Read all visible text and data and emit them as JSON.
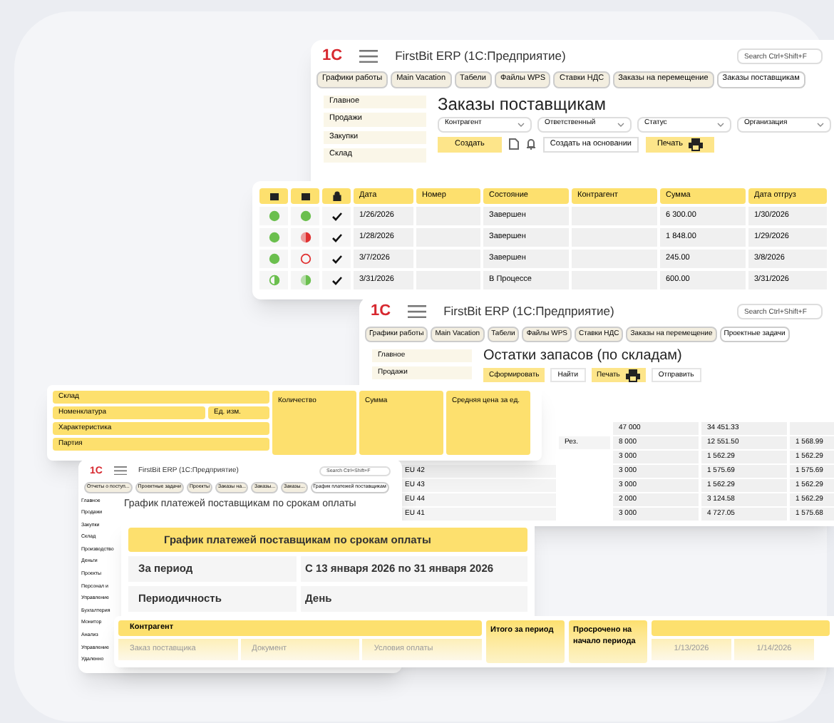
{
  "orders_window": {
    "logo": "1С",
    "title": "FirstBit ERP (1С:Предприятие)",
    "search": {
      "placeholder": "Search Ctrl+Shift+F"
    },
    "tabs": [
      {
        "label": "Графики работы",
        "selected": false
      },
      {
        "label": "Main Vacation",
        "selected": false
      },
      {
        "label": "Табели",
        "selected": false
      },
      {
        "label": "Файлы WPS",
        "selected": false
      },
      {
        "label": "Ставки НДС",
        "selected": false
      },
      {
        "label": "Заказы на перемещение",
        "selected": false
      },
      {
        "label": "Заказы поставщикам",
        "selected": true
      }
    ],
    "sidebar": [
      "Главное",
      "Продажи",
      "Закупки",
      "Склад"
    ],
    "heading": "Заказы поставщикам",
    "filters": [
      "Контрагент",
      "Ответственный",
      "Статус",
      "Организация"
    ],
    "create_button": "Создать",
    "create_based_button": "Создать на основании",
    "print_button": "Печать"
  },
  "orders_table": {
    "columns": [
      "Дата",
      "Номер",
      "Состояние",
      "Контрагент",
      "Сумма",
      "Дата отгруз"
    ],
    "rows": [
      {
        "status": {
          "kind": "full",
          "color": "#6bbf4e"
        },
        "payment": {
          "kind": "full",
          "color": "#6bbf4e"
        },
        "posted": true,
        "date": "1/26/2026",
        "number": "",
        "state": "Завершен",
        "counterparty": "",
        "sum": "6 300.00",
        "ship_date": "1/30/2026"
      },
      {
        "status": {
          "kind": "full",
          "color": "#6bbf4e"
        },
        "payment": {
          "kind": "part",
          "color": "#e03131"
        },
        "posted": true,
        "date": "1/28/2026",
        "number": "",
        "state": "Завершен",
        "counterparty": "",
        "sum": "1 848.00",
        "ship_date": "1/29/2026"
      },
      {
        "status": {
          "kind": "full",
          "color": "#6bbf4e"
        },
        "payment": {
          "kind": "empty",
          "color": "#e03131"
        },
        "posted": true,
        "date": "3/7/2026",
        "number": "",
        "state": "Завершен",
        "counterparty": "",
        "sum": "245.00",
        "ship_date": "3/8/2026"
      },
      {
        "status": {
          "kind": "half",
          "color": "#6bbf4e"
        },
        "payment": {
          "kind": "part",
          "color": "#6bbf4e"
        },
        "posted": true,
        "date": "3/31/2026",
        "number": "",
        "state": "В Процессе",
        "counterparty": "",
        "sum": "600.00",
        "ship_date": "3/31/2026"
      }
    ]
  },
  "stock_window": {
    "logo": "1С",
    "title": "FirstBit ERP (1С:Предприятие)",
    "search": {
      "placeholder": "Search Ctrl+Shift+F"
    },
    "tabs": [
      {
        "label": "Графики работы",
        "selected": false
      },
      {
        "label": "Main Vacation",
        "selected": false
      },
      {
        "label": "Табели",
        "selected": false
      },
      {
        "label": "Файлы WPS",
        "selected": false
      },
      {
        "label": "Ставки НДС",
        "selected": false
      },
      {
        "label": "Заказы на перемещение",
        "selected": false
      },
      {
        "label": "Проектные задачи",
        "selected": true
      }
    ],
    "sidebar": [
      "Главное",
      "Продажи"
    ],
    "heading": "Остатки запасов (по складам)",
    "buttons": [
      {
        "label": "Сформировать",
        "kind": "primary"
      },
      {
        "label": "Найти",
        "kind": "plain"
      },
      {
        "label": "Печать",
        "kind": "print"
      },
      {
        "label": "Отправить",
        "kind": "plain"
      }
    ],
    "rows": [
      {
        "name": "",
        "unit": "",
        "quantity": "47 000",
        "sum": "34 451.33",
        "average": ""
      },
      {
        "name": "",
        "unit": "Рез.",
        "quantity": "8 000",
        "sum": "12 551.50",
        "average": "1 568.99"
      },
      {
        "name": "",
        "unit": "",
        "quantity": "3 000",
        "sum": "1 562.29",
        "average": "1 562.29"
      },
      {
        "name": "EU 42",
        "unit": "",
        "quantity": "3 000",
        "sum": "1 575.69",
        "average": "1 575.69"
      },
      {
        "name": "EU 43",
        "unit": "",
        "quantity": "3 000",
        "sum": "1 562.29",
        "average": "1 562.29"
      },
      {
        "name": "EU 44",
        "unit": "",
        "quantity": "2 000",
        "sum": "3 124.58",
        "average": "1 562.29"
      },
      {
        "name": "EU 41",
        "unit": "",
        "quantity": "3 000",
        "sum": "4 727.05",
        "average": "1 575.68"
      }
    ]
  },
  "stock_header": {
    "warehouse": "Склад",
    "item": "Номенклатура",
    "unit": "Ед. изм.",
    "characteristic": "Характеристика",
    "batch": "Партия",
    "quantity": "Количество",
    "sum": "Сумма",
    "average": "Средняя цена за ед."
  },
  "payments_window": {
    "logo": "1С",
    "title": "FirstBit ERP (1С:Предприятие)",
    "search": {
      "placeholder": "Search Ctrl+Shift+F"
    },
    "tabs": [
      {
        "label": "Отчеты о поступ...",
        "selected": false
      },
      {
        "label": "Проектные задачи",
        "selected": false
      },
      {
        "label": "Проекты",
        "selected": false
      },
      {
        "label": "Заказы на...",
        "selected": false
      },
      {
        "label": "Заказы...",
        "selected": false
      },
      {
        "label": "Заказы...",
        "selected": false
      },
      {
        "label": "График платежей поставщикам",
        "selected": true
      }
    ],
    "sidebar": [
      "Главное",
      "Продажи",
      "Закупки",
      "Склад",
      "Производство",
      "Деньги",
      "Проекты",
      "Персонал и",
      "Управление",
      "Бухгалтерия",
      "Монитор",
      "Анализ",
      "Управление",
      "Удаленно"
    ],
    "heading": "График платежей поставщикам по срокам оплаты"
  },
  "report_settings": {
    "title": "График платежей поставщикам по срокам оплаты",
    "rows": [
      {
        "label": "За период",
        "value": "С 13 января 2026 по 31 января 2026"
      },
      {
        "label": "Периодичность",
        "value": "День"
      }
    ]
  },
  "payments_header": {
    "counterparty": "Контрагент",
    "total": "Итого за период",
    "overdue": "Просрочено на начало периода",
    "subcolumns": [
      "Заказ поставщика",
      "Документ",
      "Условия оплаты"
    ],
    "dates": [
      "1/13/2026",
      "1/14/2026"
    ]
  }
}
